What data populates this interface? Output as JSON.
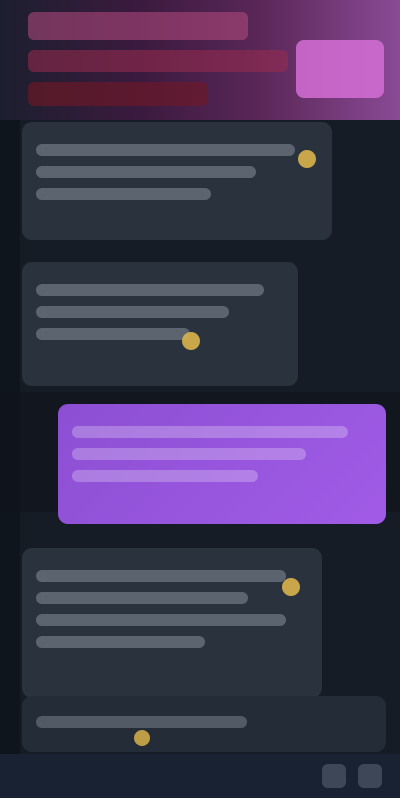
{
  "theme": {
    "background": "#151c25",
    "incoming_bubble": "#2a323d",
    "outgoing_bubble": "#a15be6",
    "accent_pink": "#d56ed6",
    "accent_red": "#6f1827",
    "emoji_yellow": "#d9b24a",
    "nav_background": "#182232"
  },
  "messages": [
    {
      "id": "m0",
      "direction": "incoming",
      "text": ""
    },
    {
      "id": "m1",
      "direction": "incoming",
      "text": ""
    },
    {
      "id": "m2",
      "direction": "incoming",
      "text": ""
    },
    {
      "id": "m3",
      "direction": "outgoing",
      "text": ""
    },
    {
      "id": "m4",
      "direction": "incoming",
      "text": ""
    }
  ],
  "composer": {
    "placeholder": ""
  },
  "nav": {
    "icons": [
      "attach-icon",
      "send-icon"
    ]
  }
}
